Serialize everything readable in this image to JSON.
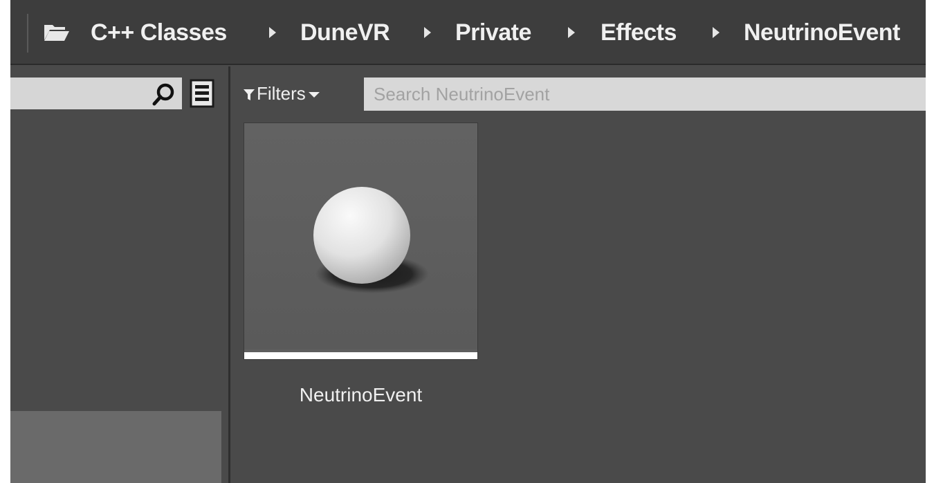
{
  "breadcrumb": {
    "items": [
      "C++ Classes",
      "DuneVR",
      "Private",
      "Effects",
      "NeutrinoEvent"
    ]
  },
  "left_panel": {
    "search_placeholder": "",
    "icons": [
      "search-icon",
      "view-options-icon"
    ]
  },
  "content": {
    "filters_label": "Filters",
    "search_placeholder": "Search NeutrinoEvent",
    "assets": [
      {
        "name": "NeutrinoEvent",
        "thumbnail": "sphere-icon",
        "type_color": "#ffffff"
      }
    ]
  },
  "colors": {
    "background": "#4a4a4a",
    "bar": "#3d3d3d",
    "search_field": "#d6d6d6",
    "text": "#f0f0f0"
  }
}
